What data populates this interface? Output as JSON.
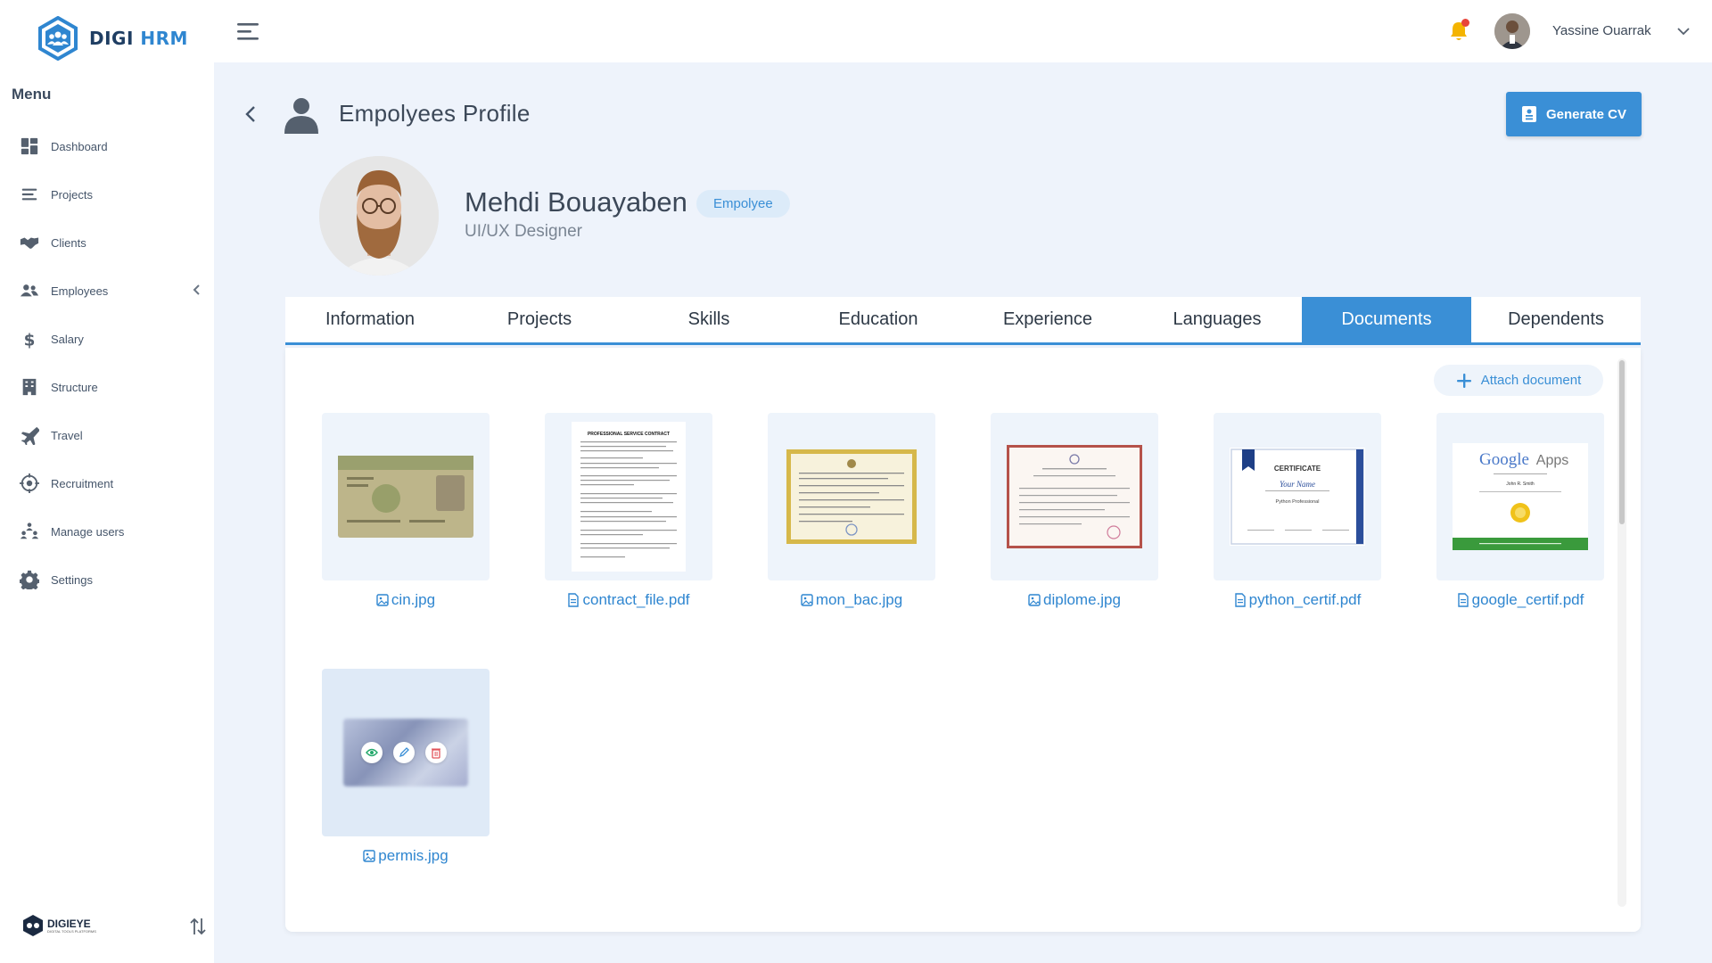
{
  "app": {
    "logo_part1": "DIGI",
    "logo_part2": " HRM",
    "footer_brand": "DIGIEYE",
    "footer_tagline": "DIGITAL TOOLS PLATFORMS"
  },
  "sidebar": {
    "menu_title": "Menu",
    "items": [
      {
        "label": "Dashboard",
        "icon": "dashboard-icon"
      },
      {
        "label": "Projects",
        "icon": "projects-icon"
      },
      {
        "label": "Clients",
        "icon": "handshake-icon"
      },
      {
        "label": "Employees",
        "icon": "users-icon"
      },
      {
        "label": "Salary",
        "icon": "dollar-icon"
      },
      {
        "label": "Structure",
        "icon": "building-icon"
      },
      {
        "label": "Travel",
        "icon": "plane-icon"
      },
      {
        "label": "Recruitment",
        "icon": "target-icon"
      },
      {
        "label": "Manage users",
        "icon": "team-icon"
      },
      {
        "label": "Settings",
        "icon": "gear-icon"
      }
    ]
  },
  "topbar": {
    "username": "Yassine Ouarrak"
  },
  "header": {
    "title": "Empolyees Profile",
    "generate_cv": "Generate CV"
  },
  "profile": {
    "name": "Mehdi Bouayaben",
    "badge": "Empolyee",
    "role": "UI/UX Designer"
  },
  "tabs": [
    "Information",
    "Projects",
    "Skills",
    "Education",
    "Experience",
    "Languages",
    "Documents",
    "Dependents"
  ],
  "active_tab": "Documents",
  "documents": {
    "attach_label": "Attach document",
    "files": [
      {
        "name": "cin.jpg",
        "type": "image"
      },
      {
        "name": "contract_file.pdf",
        "type": "pdf"
      },
      {
        "name": "mon_bac.jpg",
        "type": "image"
      },
      {
        "name": "diplome.jpg",
        "type": "image"
      },
      {
        "name": "python_certif.pdf",
        "type": "pdf"
      },
      {
        "name": "google_certif.pdf",
        "type": "pdf"
      },
      {
        "name": "permis.jpg",
        "type": "image"
      }
    ],
    "preview": {
      "contract_heading": "PROFESSIONAL SERVICE CONTRACT",
      "certificate_title": "CERTIFICATE",
      "certificate_name": "Your Name",
      "certificate_course": "Python Professional",
      "google_logo": "Google",
      "google_suffix": "Apps",
      "google_person": "John R. Smith"
    }
  },
  "colors": {
    "accent": "#3a8fd6",
    "page_bg": "#eef3fb",
    "thumb_bg": "#eef4fb"
  }
}
